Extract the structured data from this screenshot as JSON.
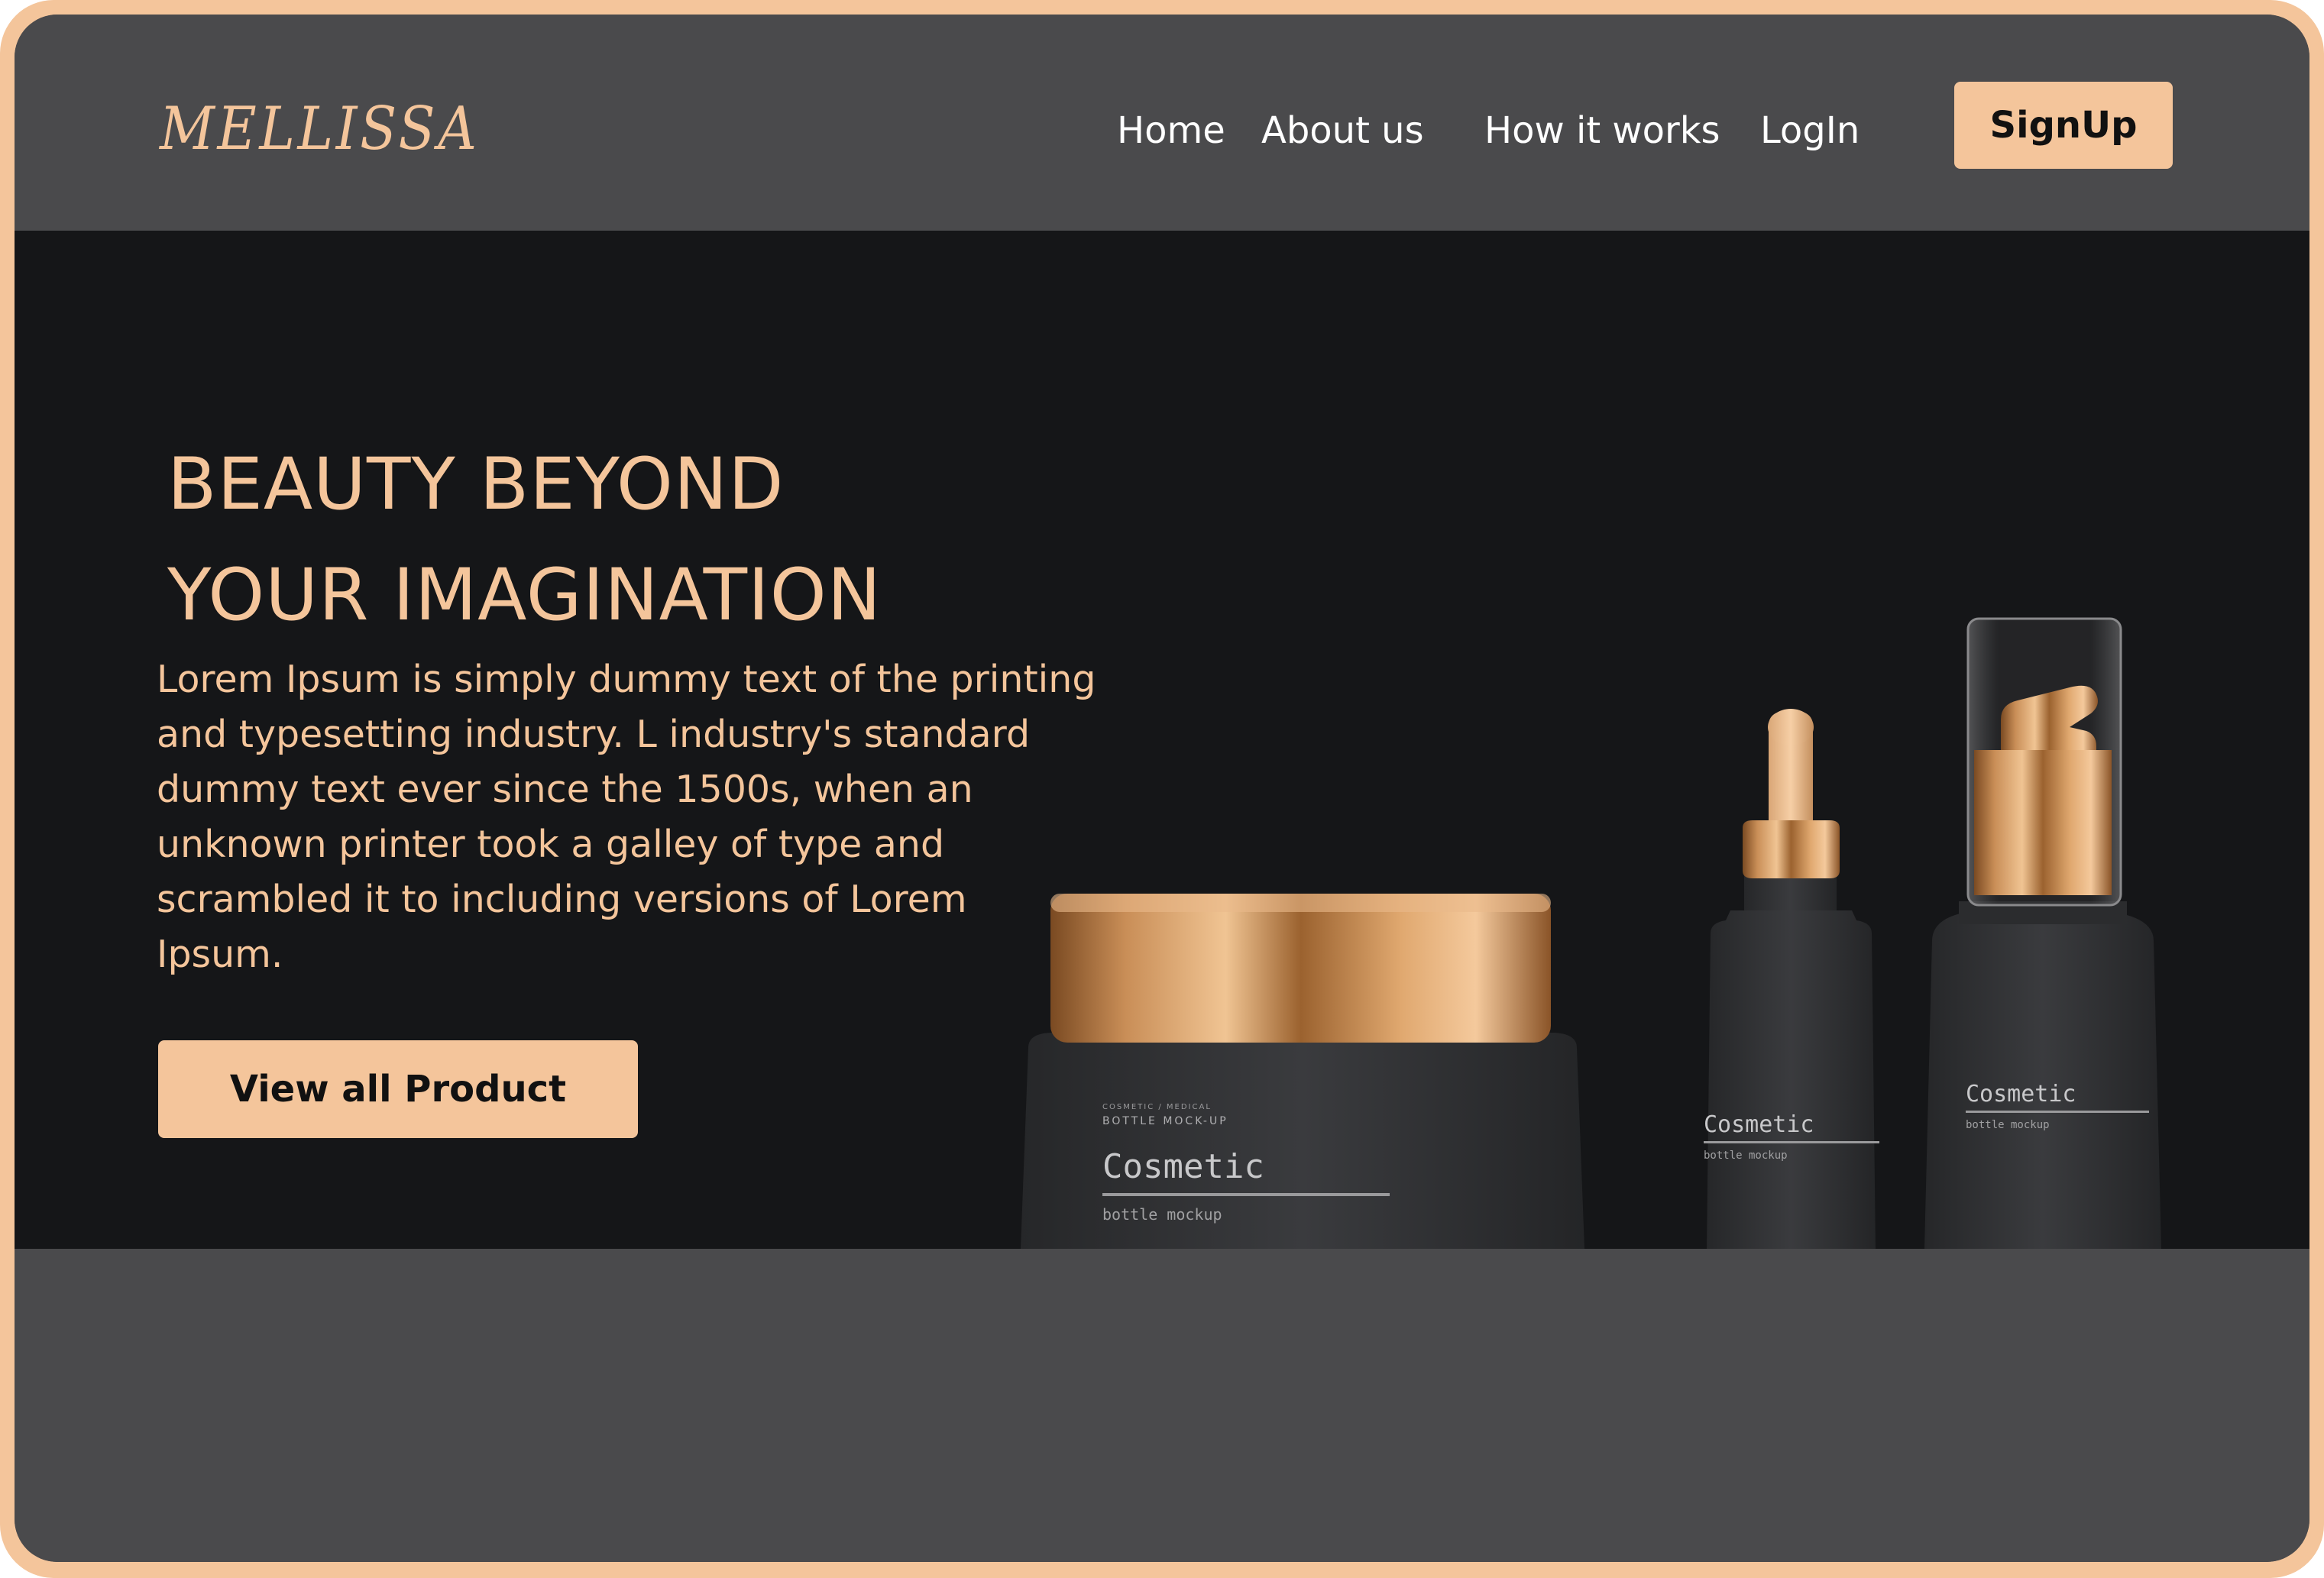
{
  "header": {
    "logo": "MELLISSA",
    "nav": [
      {
        "label": "Home"
      },
      {
        "label": "About us"
      },
      {
        "label": "How it works"
      },
      {
        "label": "LogIn"
      }
    ],
    "signup_label": "SignUp"
  },
  "hero": {
    "headline_line1": "BEAUTY BEYOND",
    "headline_line2": "YOUR IMAGINATION",
    "description": "Lorem Ipsum is simply dummy text of the printing\nand typesetting industry. L industry's standard\ndummy text ever since the 1500s, when an\nunknown printer took a galley of type and\nscrambled it to  including versions of Lorem\nIpsum.",
    "cta_label": "View all Product"
  },
  "products": {
    "jar": {
      "label_top": "COSMETIC / MEDICAL",
      "label_sub": "BOTTLE MOCK-UP",
      "label_main": "Cosmetic",
      "label_caption": "bottle mockup"
    },
    "dropper": {
      "label_main": "Cosmetic",
      "label_caption": "bottle mockup"
    },
    "pump": {
      "label_main": "Cosmetic",
      "label_caption": "bottle mockup"
    }
  },
  "colors": {
    "accent": "#f4c59b",
    "header_bg": "#4a4a4c",
    "hero_bg": "#151618",
    "gold": "#c98e57"
  }
}
